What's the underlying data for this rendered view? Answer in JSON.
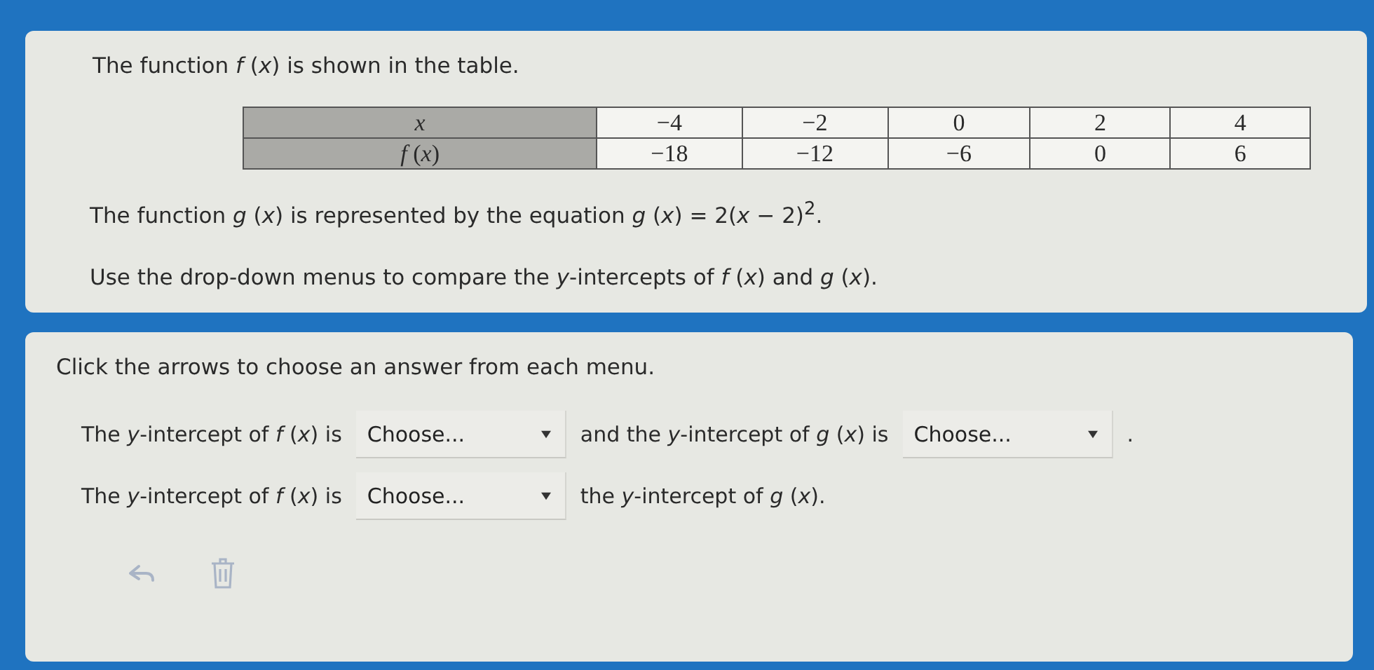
{
  "question": {
    "intro": "The function *f* (*x*) is shown in the table.",
    "table": {
      "rows": [
        {
          "header": "*x*",
          "cells": [
            "−4",
            "−2",
            "0",
            "2",
            "4"
          ]
        },
        {
          "header": "*f* (*x*)",
          "cells": [
            "−18",
            "−12",
            "−6",
            "0",
            "6"
          ]
        }
      ]
    },
    "equation": "The function *g* (*x*) is represented by the equation *g* (*x*) = 2(*x* − 2)$^{2}$.",
    "task": "Use the drop-down menus to compare the *y*-intercepts of *f* (*x*) and *g* (*x*)."
  },
  "answer": {
    "instruction": "Click the arrows to choose an answer from each menu.",
    "lines": [
      {
        "parts": [
          {
            "kind": "text",
            "text": "The *y*-intercept of *f* (*x*) is"
          },
          {
            "kind": "dropdown",
            "value": "Choose..."
          },
          {
            "kind": "text",
            "text": "and the *y*-intercept of *g* (*x*) is"
          },
          {
            "kind": "dropdown",
            "value": "Choose..."
          },
          {
            "kind": "text",
            "text": "."
          }
        ]
      },
      {
        "parts": [
          {
            "kind": "text",
            "text": "The *y*-intercept of *f* (*x*) is"
          },
          {
            "kind": "dropdown",
            "value": "Choose..."
          },
          {
            "kind": "text",
            "text": "the *y*-intercept of *g* (*x*)."
          }
        ]
      }
    ]
  }
}
